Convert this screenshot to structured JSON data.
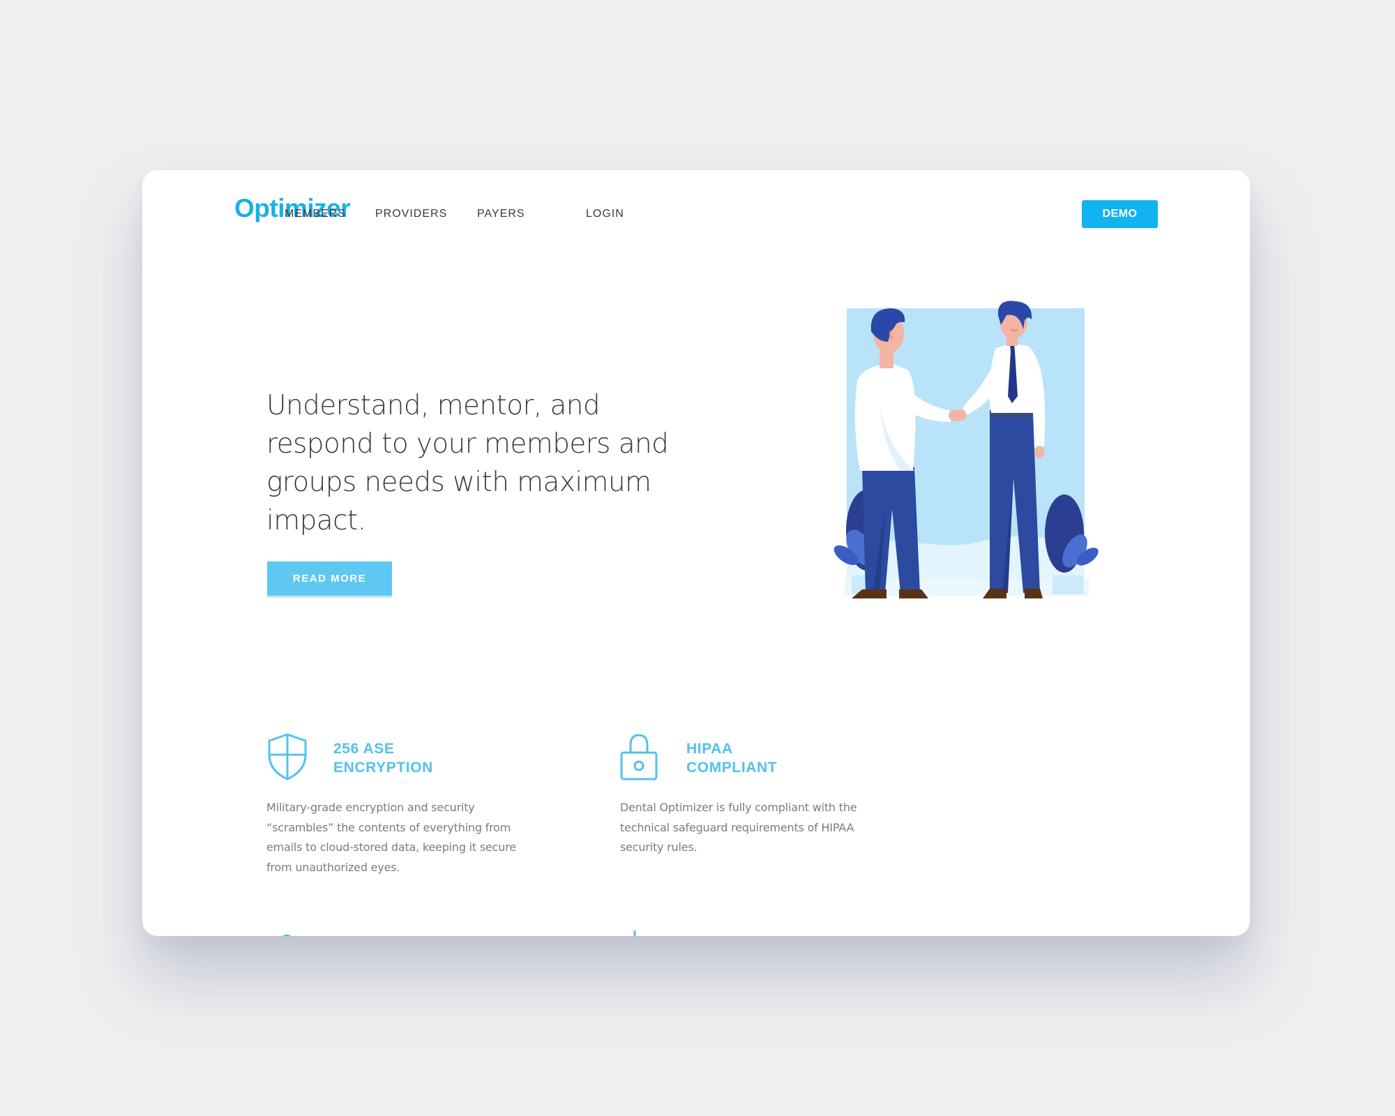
{
  "brand": {
    "logo_text": "Optimizer",
    "accent_color": "#17b0ea"
  },
  "nav": {
    "items": [
      {
        "label": "MEMBERS"
      },
      {
        "label": "PROVIDERS"
      },
      {
        "label": "PAYERS"
      },
      {
        "label": "LOGIN"
      }
    ],
    "demo_label": "DEMO"
  },
  "hero": {
    "headline": "Understand, mentor, and respond to your members and groups needs with maximum impact.",
    "cta_label": "READ MORE",
    "illustration_icon": "handshake-illustration"
  },
  "features": [
    {
      "icon": "shield-icon",
      "title_line1": "256 ASE",
      "title_line2": "ENCRYPTION",
      "description": "Military-grade encryption and security “scrambles” the contents of everything from emails to cloud-stored data, keeping it secure from unauthorized eyes."
    },
    {
      "icon": "lock-icon",
      "title_line1": "HIPAA",
      "title_line2": "COMPLIANT",
      "description": "Dental Optimizer is fully compliant with the technical safeguard requirements of HIPAA security rules."
    }
  ],
  "colors": {
    "page_background": "#eeeff0",
    "card_background": "#ffffff",
    "feature_title": "#55c0ee",
    "cta_background": "#5ec8f2",
    "illustration_sky": "#b9e3f8",
    "suit_blue": "#2b4aa0"
  }
}
